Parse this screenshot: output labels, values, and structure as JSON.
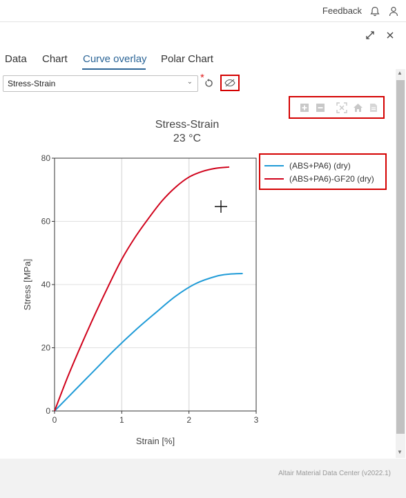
{
  "topbar": {
    "feedback_label": "Feedback",
    "bell_icon": "bell-icon",
    "user_icon": "user-icon"
  },
  "window": {
    "expand_icon": "expand-icon",
    "close_icon": "close-icon"
  },
  "tabs": [
    {
      "label": "Data"
    },
    {
      "label": "Chart"
    },
    {
      "label": "Curve overlay",
      "active": true
    },
    {
      "label": "Polar Chart"
    }
  ],
  "controls": {
    "select_value": "Stress-Strain",
    "required_mark": "*",
    "reset_icon": "reset-icon",
    "hide_icon": "eye-slash-icon"
  },
  "modebar": [
    "zoom-in-icon",
    "zoom-out-icon",
    "autoscale-icon",
    "home-icon",
    "download-icon"
  ],
  "chart_data": {
    "type": "line",
    "title": "Stress-Strain",
    "subtitle": "23 °C",
    "xlabel": "Strain [%]",
    "ylabel": "Stress [MPa]",
    "xlim": [
      0,
      3
    ],
    "ylim": [
      0,
      80
    ],
    "xticks": [
      "0",
      "1",
      "2",
      "3"
    ],
    "yticks": [
      "0",
      "20",
      "40",
      "60",
      "80"
    ],
    "grid": true,
    "legend_position": "top-right",
    "series": [
      {
        "name": "(ABS+PA6) (dry)",
        "color": "#1f9bd7",
        "x": [
          0,
          0.3,
          0.6,
          0.9,
          1.2,
          1.5,
          1.8,
          2.1,
          2.4,
          2.6,
          2.8
        ],
        "y": [
          0,
          6.5,
          13,
          19.5,
          25.5,
          31,
          36.3,
          40.3,
          42.6,
          43.3,
          43.5
        ]
      },
      {
        "name": "(ABS+PA6)-GF20 (dry)",
        "color": "#d0021b",
        "x": [
          0,
          0.2,
          0.4,
          0.6,
          0.8,
          1.0,
          1.2,
          1.4,
          1.6,
          1.8,
          2.0,
          2.2,
          2.4,
          2.6
        ],
        "y": [
          0,
          11,
          21,
          30.5,
          39.5,
          48,
          55,
          61,
          66.5,
          70.8,
          74,
          75.8,
          76.8,
          77.2
        ]
      }
    ]
  },
  "footer": {
    "text": "Altair Material Data Center (v2022.1)"
  }
}
